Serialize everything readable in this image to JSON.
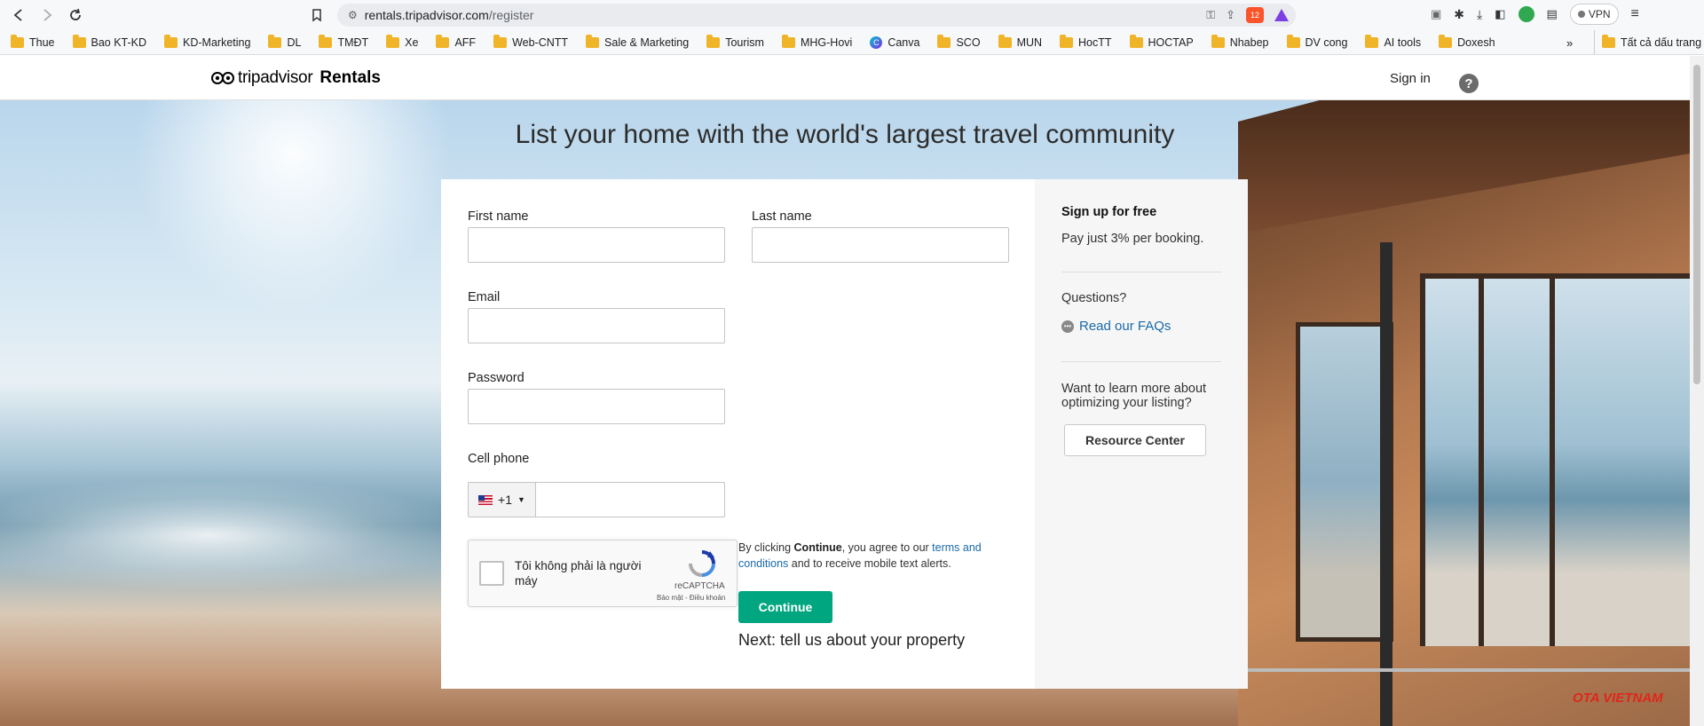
{
  "browser": {
    "url_host": "rentals.tripadvisor.com",
    "url_path": "/register",
    "vpn_label": "VPN",
    "brave_badge": "12",
    "bookmarks": [
      {
        "label": "Thue",
        "icon": "folder"
      },
      {
        "label": "Bao KT-KD",
        "icon": "folder"
      },
      {
        "label": "KD-Marketing",
        "icon": "folder"
      },
      {
        "label": "DL",
        "icon": "folder"
      },
      {
        "label": "TMĐT",
        "icon": "folder"
      },
      {
        "label": "Xe",
        "icon": "folder"
      },
      {
        "label": "AFF",
        "icon": "folder"
      },
      {
        "label": "Web-CNTT",
        "icon": "folder"
      },
      {
        "label": "Sale & Marketing",
        "icon": "folder"
      },
      {
        "label": "Tourism",
        "icon": "folder"
      },
      {
        "label": "MHG-Hovi",
        "icon": "folder"
      },
      {
        "label": "Canva",
        "icon": "canva"
      },
      {
        "label": "SCO",
        "icon": "folder"
      },
      {
        "label": "MUN",
        "icon": "folder"
      },
      {
        "label": "HocTT",
        "icon": "folder"
      },
      {
        "label": "HOCTAP",
        "icon": "folder"
      },
      {
        "label": "Nhabep",
        "icon": "folder"
      },
      {
        "label": "DV cong",
        "icon": "folder"
      },
      {
        "label": "AI tools",
        "icon": "folder"
      },
      {
        "label": "Doxesh",
        "icon": "folder"
      }
    ],
    "bookmarks_more": "»",
    "all_bookmarks": "Tất cả dấu trang"
  },
  "header": {
    "logo_brand": "tripadvisor",
    "logo_product": "Rentals",
    "signin": "Sign in",
    "help": "?"
  },
  "hero": {
    "title": "List your home with the world's largest travel community"
  },
  "form": {
    "first_name_label": "First name",
    "last_name_label": "Last name",
    "email_label": "Email",
    "password_label": "Password",
    "cell_phone_label": "Cell phone",
    "phone_country_code": "+1",
    "recaptcha_text": "Tôi không phải là người máy",
    "recaptcha_brand": "reCAPTCHA",
    "recaptcha_links": "Bảo mật - Điều khoản",
    "terms_prefix": "By clicking ",
    "terms_bold": "Continue",
    "terms_mid": ", you agree to our ",
    "terms_link": "terms and conditions",
    "terms_suffix": " and to receive mobile text alerts.",
    "continue_label": "Continue",
    "next_text": "Next: tell us about your property"
  },
  "aside": {
    "signup_heading": "Sign up for free",
    "signup_text": "Pay just 3% per booking.",
    "questions": "Questions?",
    "faq_link": "Read our FAQs",
    "learn_more": "Want to learn more about optimizing your listing?",
    "resource_button": "Resource Center"
  },
  "watermark": "OTA VIETNAM",
  "colors": {
    "accent_green": "#00a680",
    "link_blue": "#1a6aa8"
  }
}
